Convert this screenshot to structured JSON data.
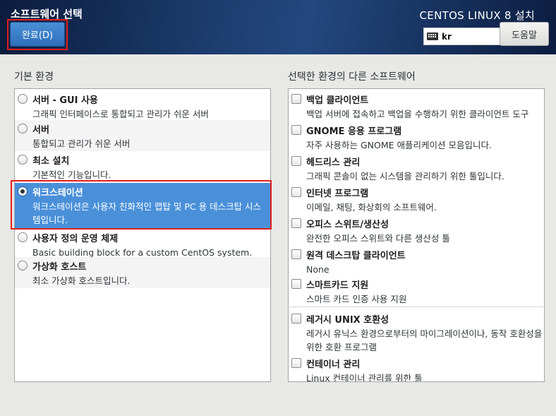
{
  "header": {
    "spoke_title": "소프트웨어 선택",
    "done_label": "완료(D)",
    "product_title": "CENTOS LINUX 8 설치",
    "keyboard_layout": "kr",
    "help_label": "도움말"
  },
  "base_environment": {
    "label": "기본 환경",
    "selected_index": 3,
    "items": [
      {
        "name": "서버 - GUI 사용",
        "desc": "그래픽 인터페이스로 통합되고 관리가 쉬운 서버"
      },
      {
        "name": "서버",
        "desc": "통합되고 관리가 쉬운 서버"
      },
      {
        "name": "최소 설치",
        "desc": "기본적인 기능입니다."
      },
      {
        "name": "워크스테이션",
        "desc": "워크스테이션은 사용자 친화적인 랩탑 및 PC 용 데스크탑 시스템입니다."
      },
      {
        "name": "사용자 정의 운영 체제",
        "desc": "Basic building block for a custom CentOS system."
      },
      {
        "name": "가상화 호스트",
        "desc": "최소 가상화 호스트입니다."
      }
    ]
  },
  "addons": {
    "label": "선택한 환경의 다른 소프트웨어",
    "items": [
      {
        "name": "백업 클라이언트",
        "desc": "백업 서버에 접속하고 백업을 수행하기 위한 클라이언트 도구",
        "checked": false
      },
      {
        "name": "GNOME 응용 프로그램",
        "desc": "자주 사용하는 GNOME 애플리케이션 모음입니다.",
        "checked": false
      },
      {
        "name": "헤드리스 관리",
        "desc": "그래픽 콘솔이 없는 시스템을 관리하기 위한 툴입니다.",
        "checked": false
      },
      {
        "name": "인터넷 프로그램",
        "desc": "이메일, 채팅, 화상회의 소프트웨어.",
        "checked": false
      },
      {
        "name": "오피스 스위트/생산성",
        "desc": "완전한 오피스 스위트와 다른 생산성 툴",
        "checked": false
      },
      {
        "name": "원격 데스크탑 클라이언트",
        "desc": "None",
        "checked": false
      },
      {
        "name": "스마트카드 지원",
        "desc": "스마트 카드 인증 사용 지원",
        "checked": false
      },
      {
        "name": "레거시 UNIX 호환성",
        "desc": "레거시 유닉스 환경으로부터의 마이그레이션이나, 동작 호환성을 위한 호환 프로그램",
        "checked": false
      },
      {
        "name": "컨테이너 관리",
        "desc": "Linux 컨테이너 관리를 위한 툴",
        "checked": false
      }
    ]
  }
}
